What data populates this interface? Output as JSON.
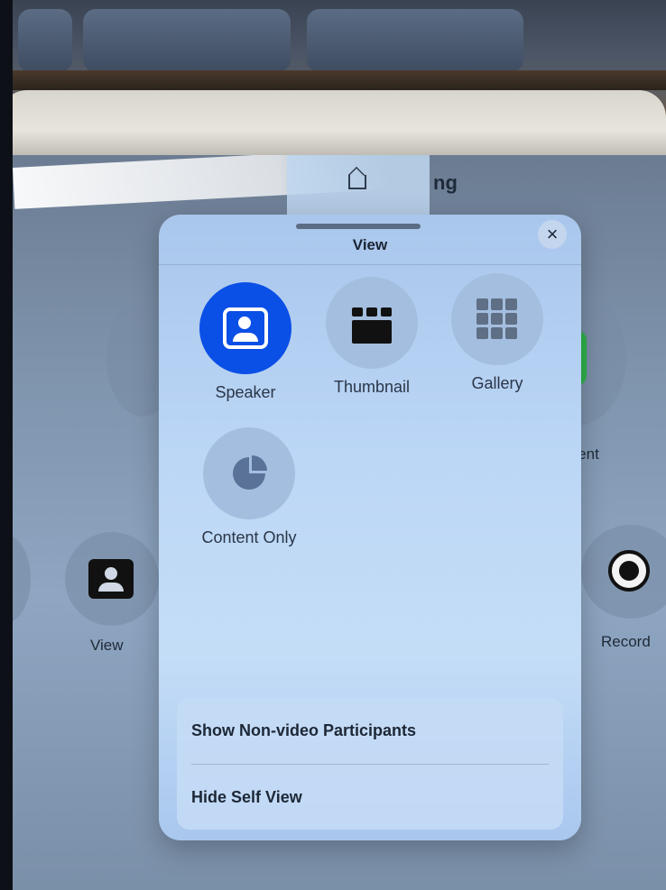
{
  "header": {
    "title_fragment": "ng"
  },
  "modal": {
    "title": "View",
    "close_glyph": "×",
    "options": [
      {
        "label": "Speaker",
        "icon": "speaker-icon",
        "selected": true
      },
      {
        "label": "Thumbnail",
        "icon": "thumbnail-icon",
        "selected": false
      },
      {
        "label": "Gallery",
        "icon": "gallery-icon",
        "selected": false
      },
      {
        "label": "Content Only",
        "icon": "content-only-icon",
        "selected": false
      }
    ],
    "list": [
      {
        "label": "Show Non-video Participants"
      },
      {
        "label": "Hide Self View"
      }
    ],
    "accent_color": "#0a4fe6"
  },
  "background_buttons": {
    "content_fragment": "ntent",
    "view_label": "View",
    "record_label": "Record"
  }
}
